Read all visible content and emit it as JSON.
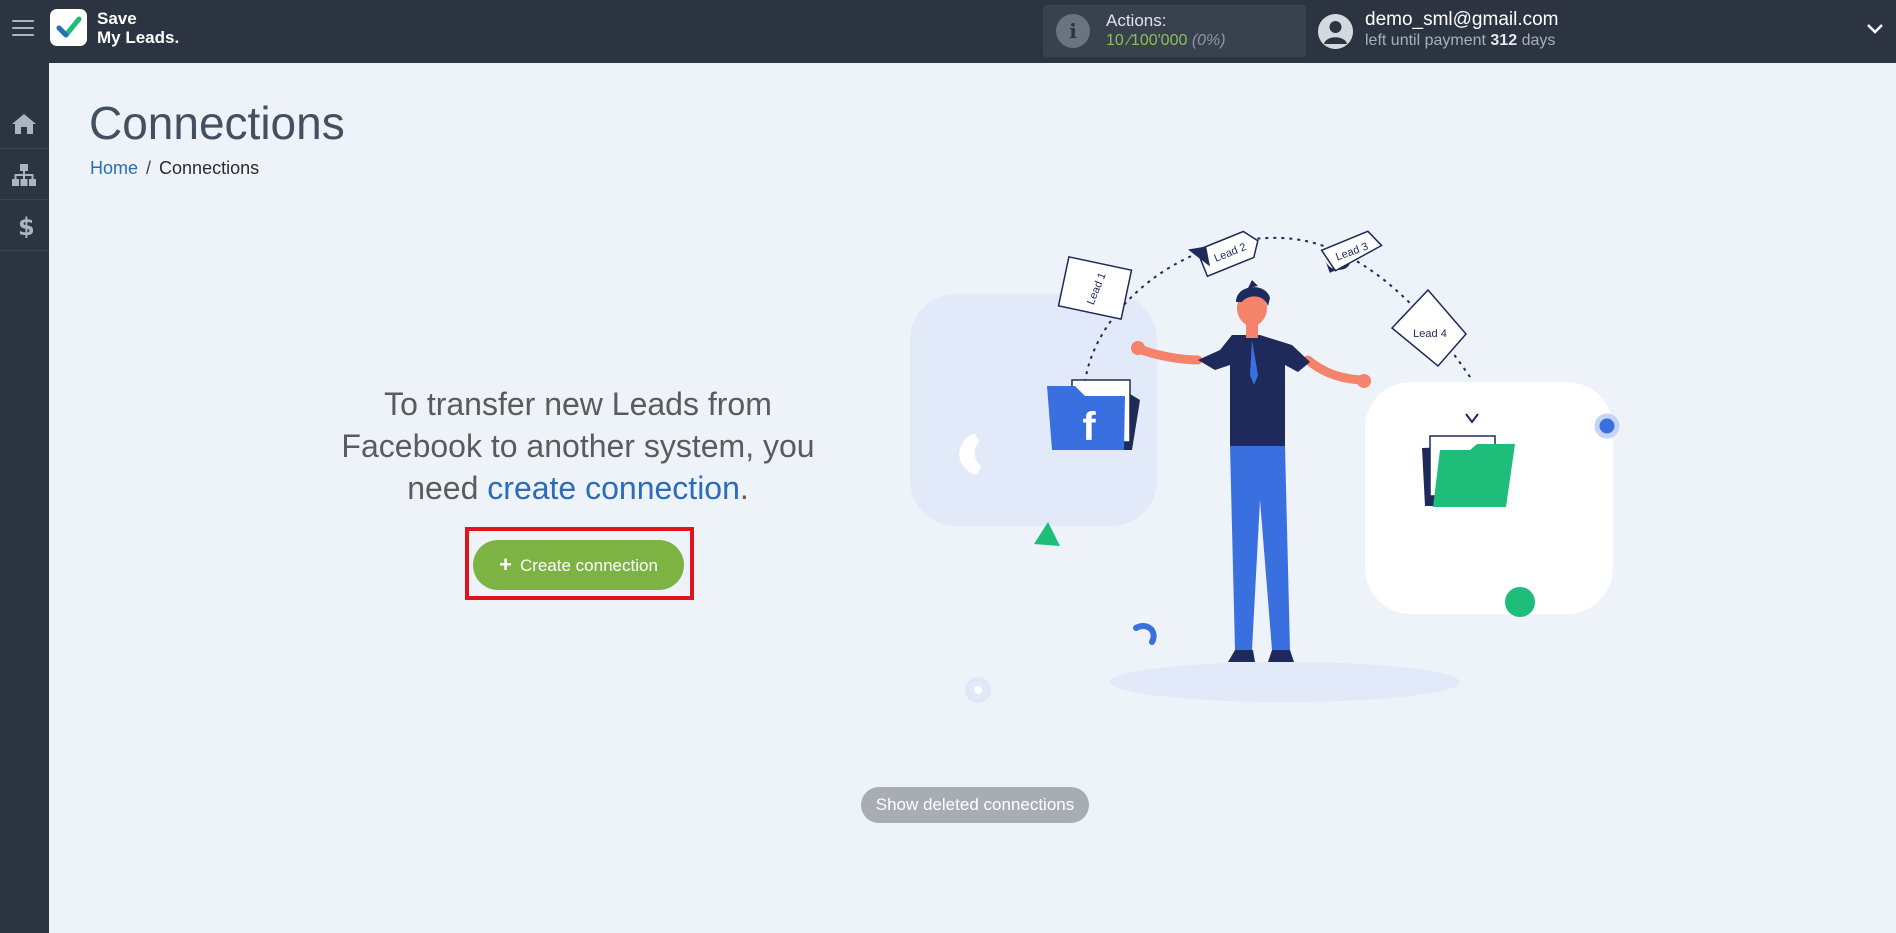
{
  "app": {
    "logo_line1": "Save",
    "logo_line2": "My Leads."
  },
  "header": {
    "actions_label": "Actions:",
    "actions_value": "10 ⁄100'000",
    "actions_pct": "(0%)",
    "user_email": "demo_sml@gmail.com",
    "payment_prefix": "left until payment",
    "payment_days": "312",
    "payment_suffix": "days"
  },
  "sidebar": {
    "items": [
      {
        "name": "home",
        "icon": "home-icon"
      },
      {
        "name": "connections",
        "icon": "sitemap-icon"
      },
      {
        "name": "billing",
        "icon": "dollar-icon"
      }
    ]
  },
  "main": {
    "title": "Connections",
    "breadcrumb": {
      "home": "Home",
      "separator": "/",
      "current": "Connections"
    },
    "intro_text": "To transfer new Leads from Facebook to another system, you need",
    "intro_link": "create connection",
    "intro_end": ".",
    "create_button": "Create connection",
    "show_deleted_button": "Show deleted connections"
  },
  "illustration": {
    "lead_labels": [
      "Lead 1",
      "Lead 2",
      "Lead 3",
      "Lead 4"
    ],
    "facebook_letter": "f"
  },
  "colors": {
    "topbar": "#2d3441",
    "accent_green": "#7cb342",
    "link_blue": "#2a6db8",
    "highlight_red": "#e0141e",
    "folder_green": "#1ebd7a",
    "folder_blue": "#3a6fe0"
  }
}
